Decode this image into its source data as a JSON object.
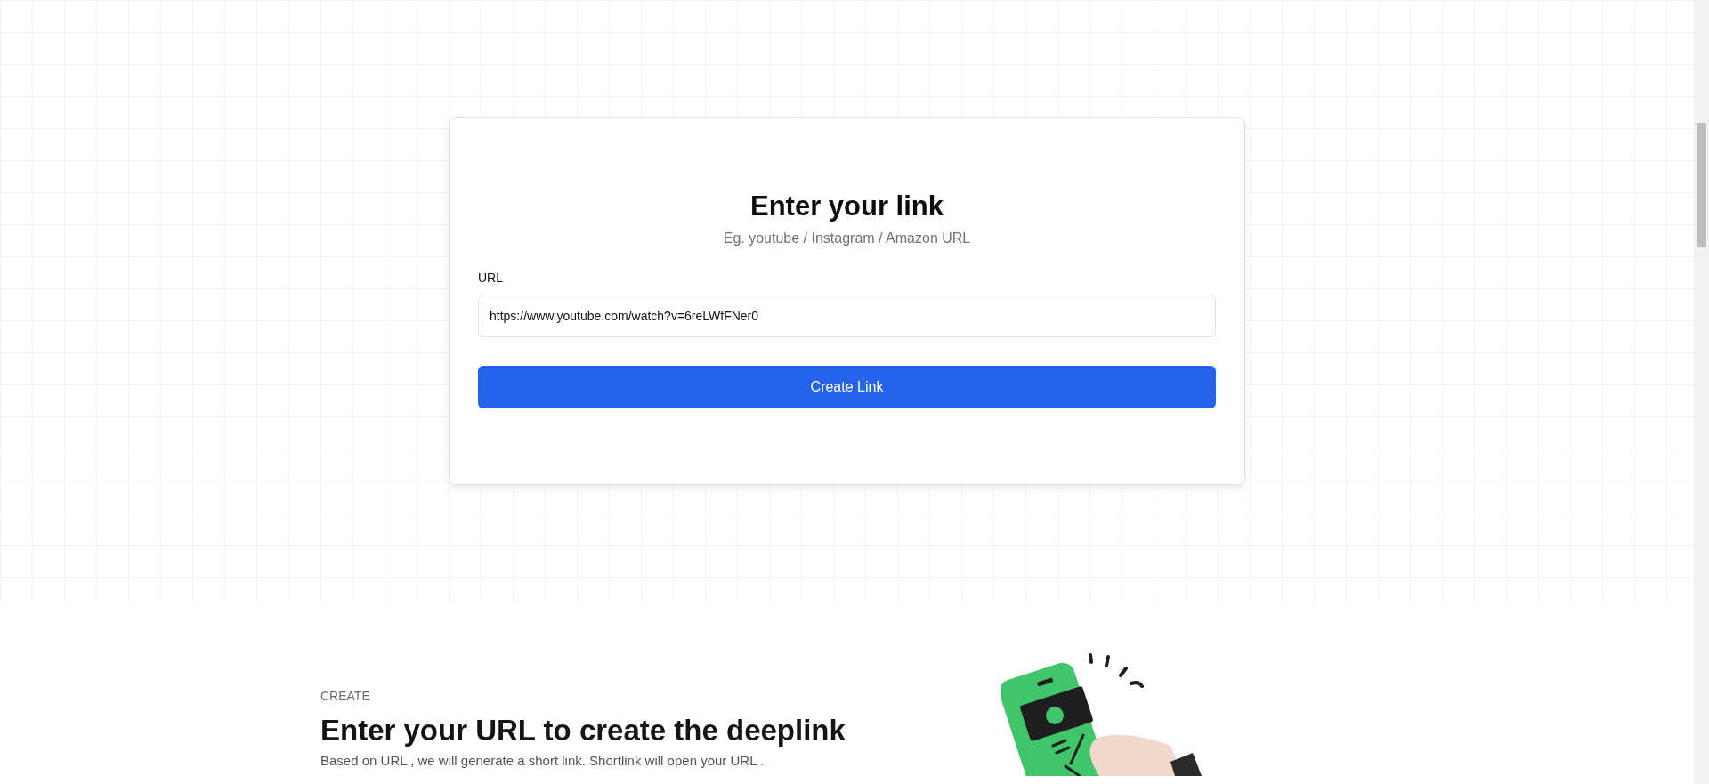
{
  "form": {
    "title": "Enter your link",
    "subtitle": "Eg. youtube / Instagram / Amazon URL",
    "field_label": "URL",
    "url_value": "https://www.youtube.com/watch?v=6reLWfFNer0",
    "button": "Create Link"
  },
  "feature": {
    "eyebrow": "CREATE",
    "heading": "Enter your URL to create the deeplink",
    "text": "Based on URL , we will generate a short link. Shortlink will open your URL ."
  }
}
